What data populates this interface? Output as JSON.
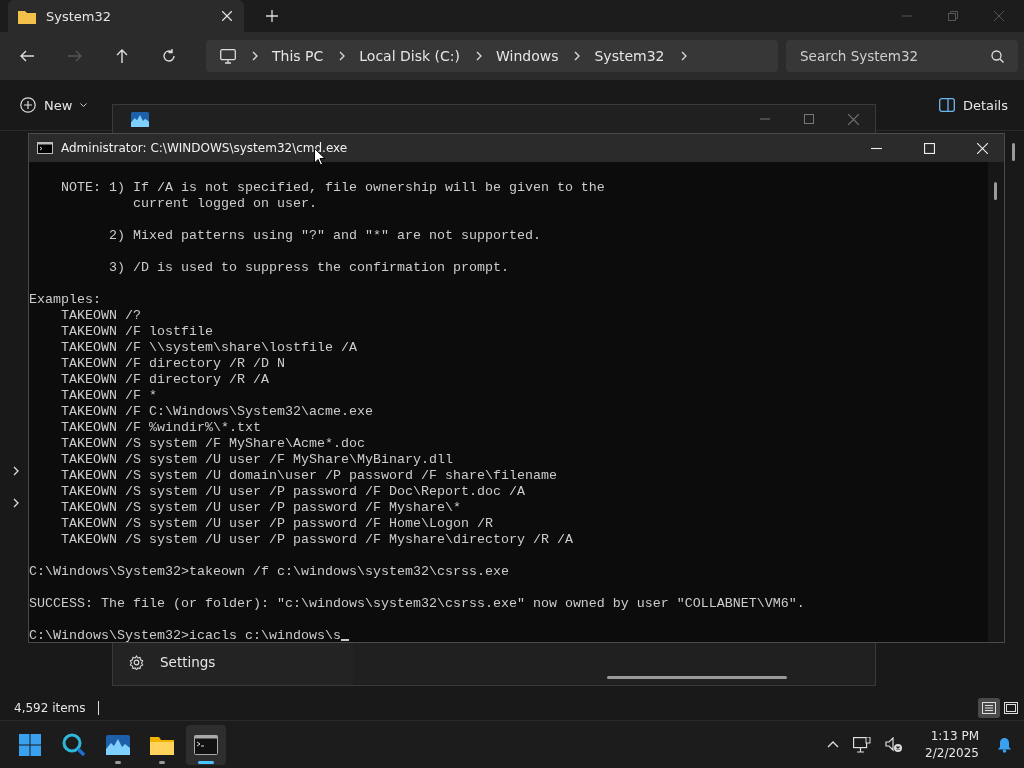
{
  "explorer": {
    "tab": {
      "title": "System32"
    },
    "breadcrumb": [
      "This PC",
      "Local Disk (C:)",
      "Windows",
      "System32"
    ],
    "search": {
      "placeholder": "Search System32"
    },
    "new_button": "New",
    "details_button": "Details",
    "status": "4,592 items",
    "view_buttons": [
      {
        "kind": "details",
        "selected": true
      },
      {
        "kind": "tiles",
        "selected": false
      }
    ]
  },
  "task_manager": {
    "nav_item": "Settings"
  },
  "cmd": {
    "title": "Administrator: C:\\WINDOWS\\system32\\cmd.exe",
    "blocks": [
      [
        "    NOTE: 1) If /A is not specified, file ownership will be given to the",
        "             current logged on user."
      ],
      [
        "          2) Mixed patterns using \"?\" and \"*\" are not supported."
      ],
      [
        "          3) /D is used to suppress the confirmation prompt."
      ],
      [
        "Examples:",
        "    TAKEOWN /?",
        "    TAKEOWN /F lostfile",
        "    TAKEOWN /F \\\\system\\share\\lostfile /A",
        "    TAKEOWN /F directory /R /D N",
        "    TAKEOWN /F directory /R /A",
        "    TAKEOWN /F *",
        "    TAKEOWN /F C:\\Windows\\System32\\acme.exe",
        "    TAKEOWN /F %windir%\\*.txt",
        "    TAKEOWN /S system /F MyShare\\Acme*.doc",
        "    TAKEOWN /S system /U user /F MyShare\\MyBinary.dll",
        "    TAKEOWN /S system /U domain\\user /P password /F share\\filename",
        "    TAKEOWN /S system /U user /P password /F Doc\\Report.doc /A",
        "    TAKEOWN /S system /U user /P password /F Myshare\\*",
        "    TAKEOWN /S system /U user /P password /F Home\\Logon /R",
        "    TAKEOWN /S system /U user /P password /F Myshare\\directory /R /A"
      ],
      [
        "C:\\Windows\\System32>takeown /f c:\\windows\\system32\\csrss.exe"
      ],
      [
        "SUCCESS: The file (or folder): \"c:\\windows\\system32\\csrss.exe\" now owned by user \"COLLABNET\\VM6\"."
      ]
    ],
    "input": "C:\\Windows\\System32>icacls c:\\windows\\s"
  },
  "taskbar": {
    "apps": [
      {
        "kind": "start",
        "running": false,
        "active": false
      },
      {
        "kind": "search",
        "running": false,
        "active": false
      },
      {
        "kind": "taskmanager",
        "running": true,
        "active": false
      },
      {
        "kind": "explorer",
        "running": true,
        "active": false
      },
      {
        "kind": "terminal",
        "running": true,
        "active": true
      }
    ],
    "time": "1:13 PM",
    "date": "2/2/2025"
  }
}
